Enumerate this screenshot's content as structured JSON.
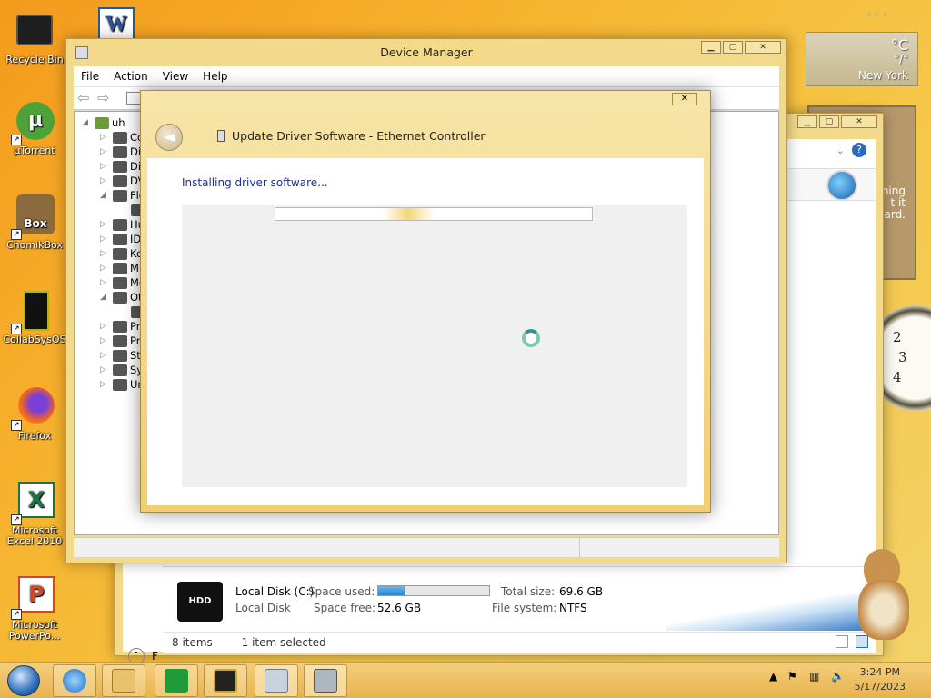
{
  "desktop": {
    "icons": [
      {
        "label": "Recycle Bin",
        "icon": "recycle-bin-icon"
      },
      {
        "label": "",
        "icon": "word-icon"
      },
      {
        "label": "µTorrent",
        "icon": "utorrent-icon"
      },
      {
        "label": "ChomikBox",
        "icon": "chomikbox-icon"
      },
      {
        "label": "CollabSysOS",
        "icon": "collabsys-icon"
      },
      {
        "label": "Firefox",
        "icon": "firefox-icon"
      },
      {
        "label": "Microsoft Excel 2010",
        "icon": "excel-icon"
      },
      {
        "label": "Microsoft PowerPo...",
        "icon": "powerpoint-icon"
      }
    ]
  },
  "weather": {
    "unit": "°C",
    "temp": "°/°",
    "city": "New York"
  },
  "photo_gadget": {
    "text_lines": [
      "ning",
      "t it",
      "board."
    ]
  },
  "clock_gadget": {
    "numbers": [
      "2",
      "3",
      "4"
    ]
  },
  "explorer": {
    "drive": {
      "name": "Local Disk (C:)",
      "type": "Local Disk",
      "space_used_label": "Space used:",
      "space_free_label": "Space free:",
      "space_free": "52.6 GB",
      "total_size_label": "Total size:",
      "total_size": "69.6 GB",
      "file_system_label": "File system:",
      "file_system": "NTFS",
      "used_fraction": 0.24,
      "hdd_label": "HDD"
    },
    "status": {
      "items": "8 items",
      "selected": "1 item selected"
    },
    "left_letter": "F"
  },
  "device_manager": {
    "title": "Device Manager",
    "menu": [
      "File",
      "Action",
      "View",
      "Help"
    ],
    "tree_root": "uh",
    "tree_items": [
      "Co",
      "Dis",
      "Dis",
      "DV",
      "Flo",
      "",
      "Hu",
      "ID",
      "Ke",
      "Mi",
      "Mo",
      "Ot",
      "",
      "Pri",
      "Pri",
      "Sto",
      "Sys",
      "Un"
    ]
  },
  "update_dialog": {
    "title": "Update Driver Software - Ethernet Controller",
    "status": "Installing driver software...",
    "back_glyph": "◄",
    "close_glyph": "✕"
  },
  "taskbar": {
    "time": "3:24 PM",
    "date": "5/17/2023",
    "buttons": [
      "internet-explorer-icon",
      "file-explorer-icon",
      "store-icon",
      "chomikbox-taskbar-icon",
      "device-manager-taskbar-icon",
      "update-driver-taskbar-icon"
    ]
  },
  "colors": {
    "accent": "#f3d98a",
    "link": "#1e3287",
    "bar": "#3c97d6"
  }
}
